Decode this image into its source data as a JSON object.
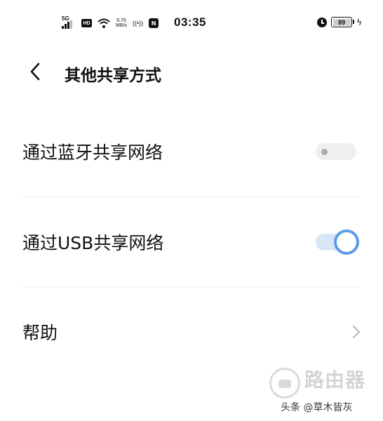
{
  "status_bar": {
    "network": "5G",
    "hd": "HD",
    "speed_value": "9.70",
    "speed_unit": "MB/s",
    "hotspot": "((•))",
    "nfc": "N",
    "time": "03:35",
    "battery": "89"
  },
  "header": {
    "title": "其他共享方式",
    "back_icon": "chevron-left-icon"
  },
  "settings": [
    {
      "label": "通过蓝牙共享网络",
      "control": "toggle",
      "state": "off"
    },
    {
      "label": "通过USB共享网络",
      "control": "toggle",
      "state": "on"
    },
    {
      "label": "帮助",
      "control": "chevron",
      "icon": "chevron-right-icon"
    }
  ],
  "watermark": {
    "name": "路由器",
    "credit": "头条 @草木皆灰"
  },
  "colors": {
    "accent": "#5b9ce8",
    "toggle_on_track": "#d9e6f7",
    "toggle_off_track": "#efefef"
  }
}
